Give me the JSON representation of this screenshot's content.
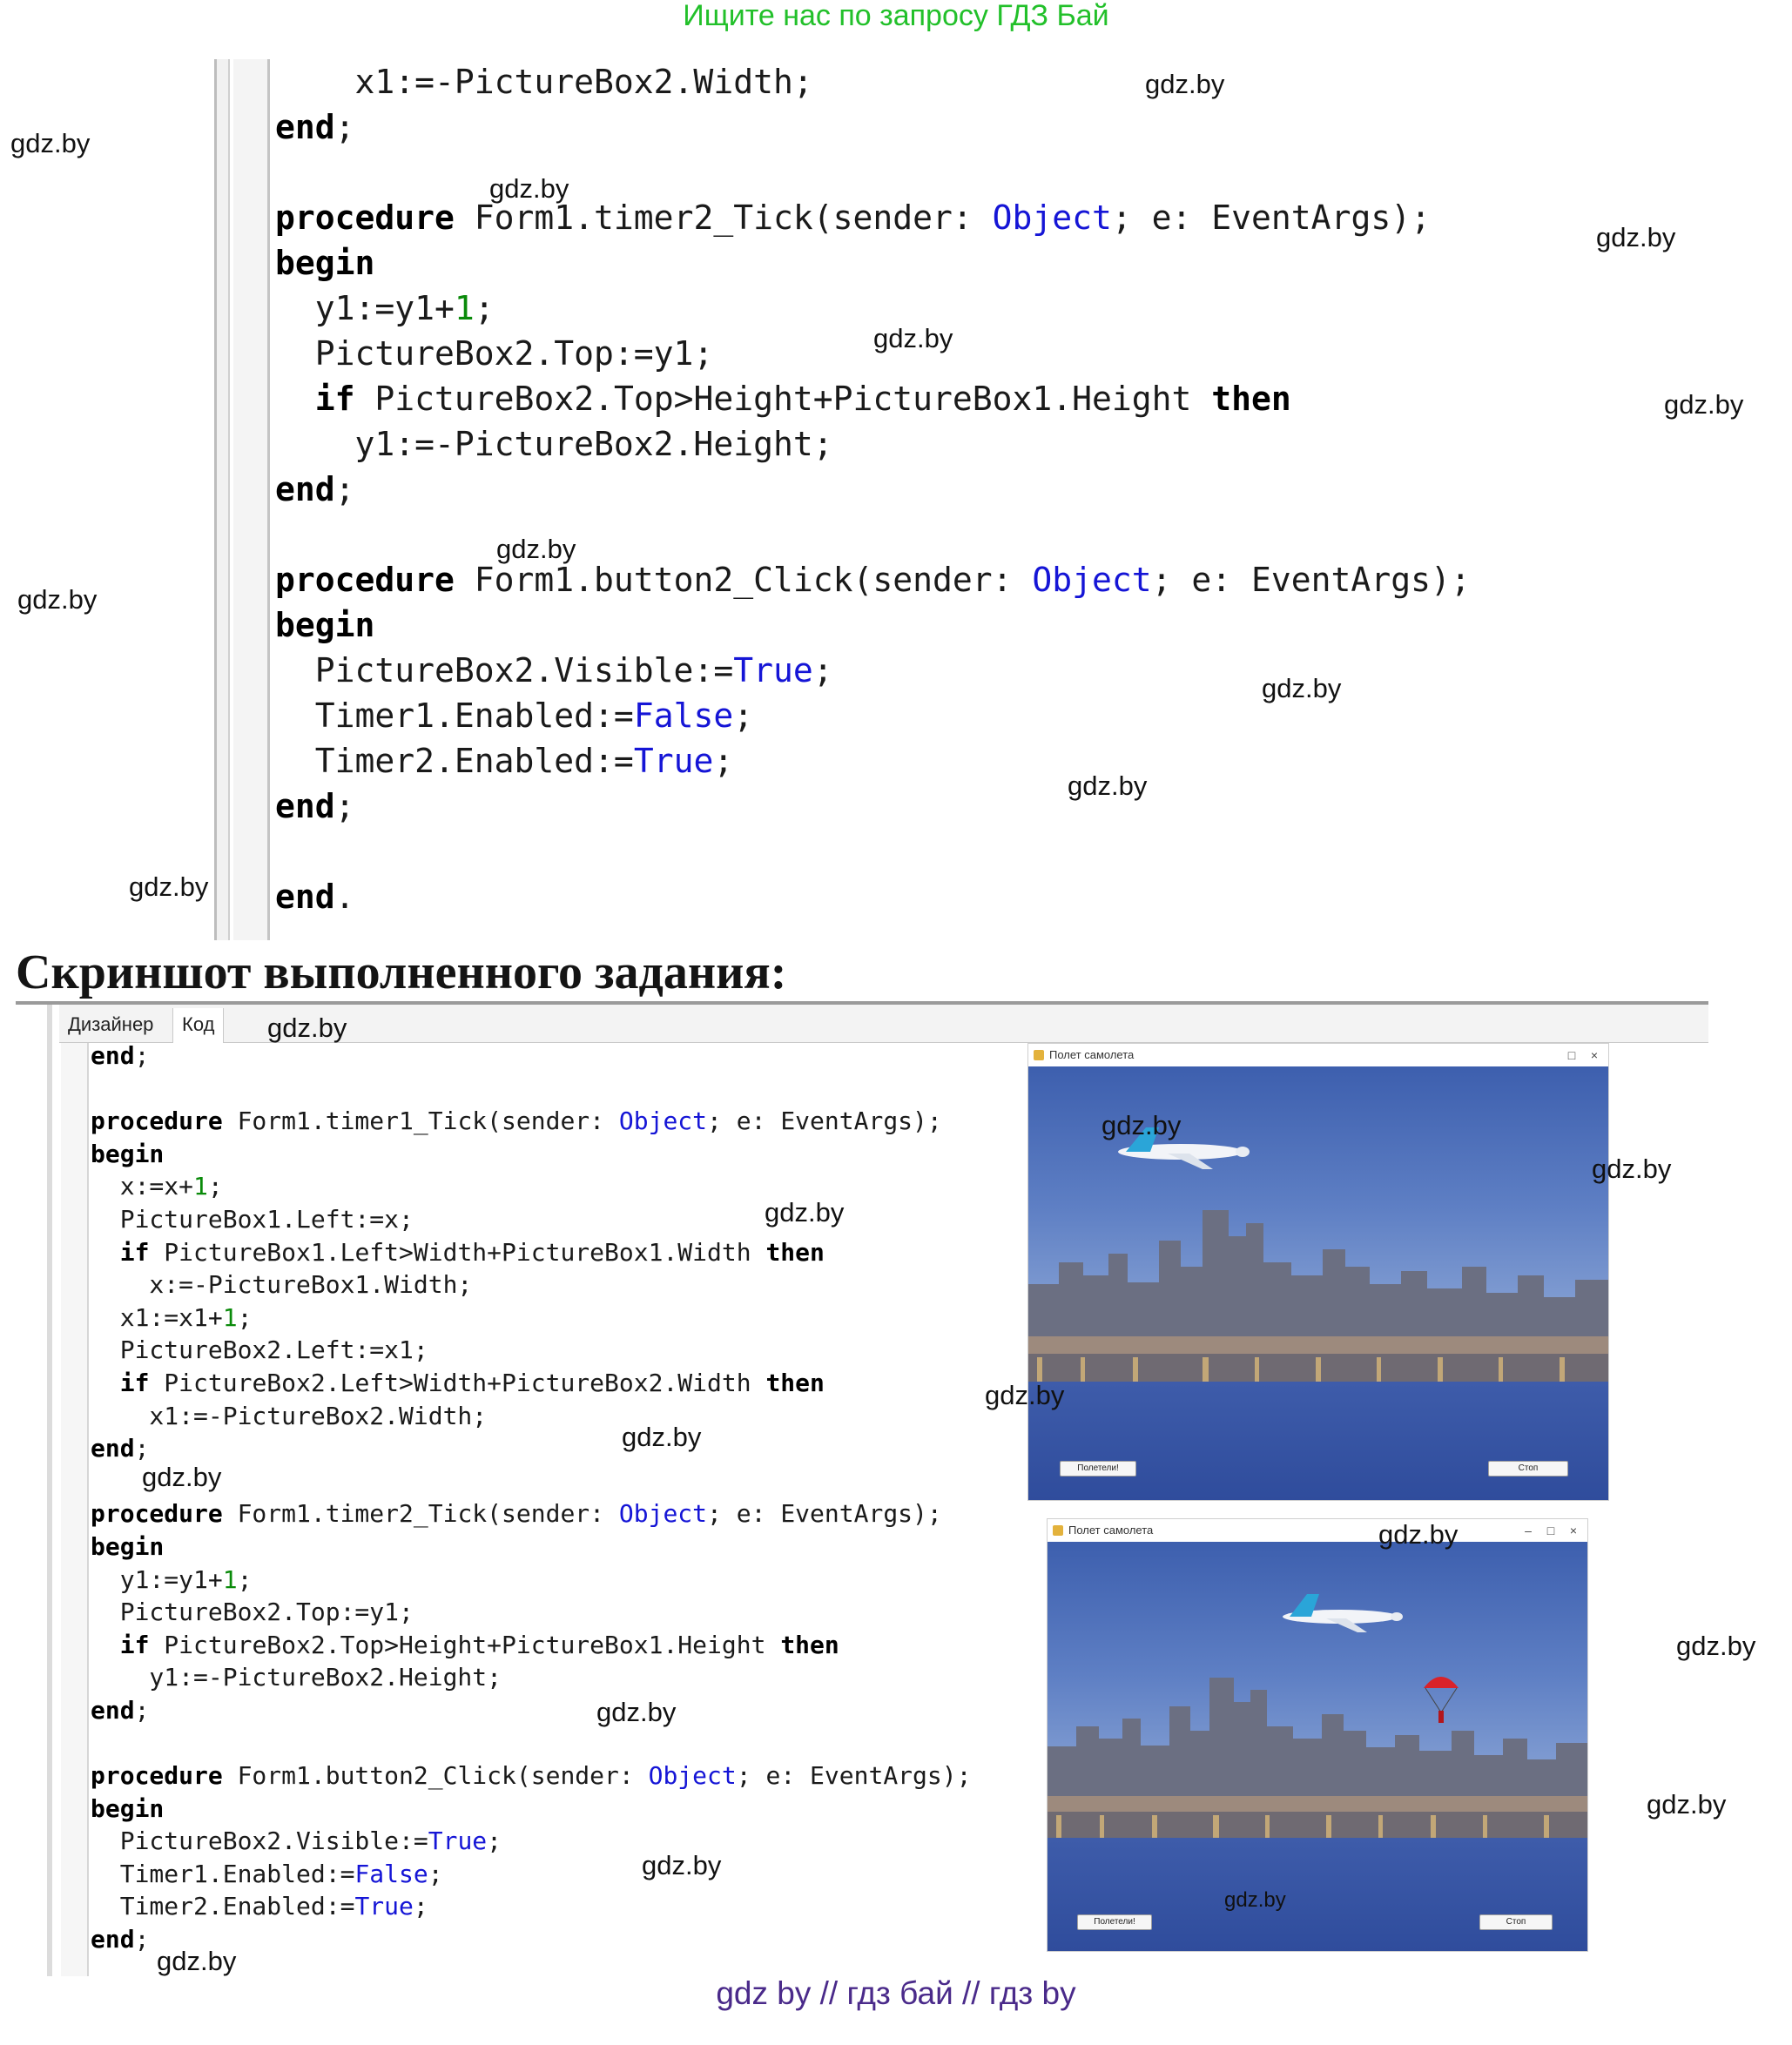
{
  "banner": "Ищите нас по запросу ГДЗ Бай",
  "caption": "Скриншот выполненного задания:",
  "editor": {
    "tab_designer": "Дизайнер",
    "tab_code": "Код"
  },
  "code_top": [
    "    x1:=-PictureBox2.Width;",
    "end;",
    "",
    "procedure Form1.timer2_Tick(sender: Object; e: EventArgs);",
    "begin",
    "  y1:=y1+1;",
    "  PictureBox2.Top:=y1;",
    "  if PictureBox2.Top>Height+PictureBox1.Height then",
    "    y1:=-PictureBox2.Height;",
    "end;",
    "",
    "procedure Form1.button2_Click(sender: Object; e: EventArgs);",
    "begin",
    "  PictureBox2.Visible:=True;",
    "  Timer1.Enabled:=False;",
    "  Timer2.Enabled:=True;",
    "end;",
    "",
    "end."
  ],
  "code_bottom": [
    "end;",
    "",
    "procedure Form1.timer1_Tick(sender: Object; e: EventArgs);",
    "begin",
    "  x:=x+1;",
    "  PictureBox1.Left:=x;",
    "  if PictureBox1.Left>Width+PictureBox1.Width then",
    "    x:=-PictureBox1.Width;",
    "  x1:=x1+1;",
    "  PictureBox2.Left:=x1;",
    "  if PictureBox2.Left>Width+PictureBox2.Width then",
    "    x1:=-PictureBox2.Width;",
    "end;",
    "",
    "procedure Form1.timer2_Tick(sender: Object; e: EventArgs);",
    "begin",
    "  y1:=y1+1;",
    "  PictureBox2.Top:=y1;",
    "  if PictureBox2.Top>Height+PictureBox1.Height then",
    "    y1:=-PictureBox2.Height;",
    "end;",
    "",
    "procedure Form1.button2_Click(sender: Object; e: EventArgs);",
    "begin",
    "  PictureBox2.Visible:=True;",
    "  Timer1.Enabled:=False;",
    "  Timer2.Enabled:=True;",
    "end;"
  ],
  "window1": {
    "title": "Полет самолета",
    "btn_left": "Полетели!",
    "btn_right": "Стоп"
  },
  "window2": {
    "title": "Полет самолета",
    "btn_left": "Полетели!",
    "btn_right": "Стоп"
  },
  "watermark": "gdz.by",
  "footer": "gdz by  //  гдз бай  //  гдз by"
}
